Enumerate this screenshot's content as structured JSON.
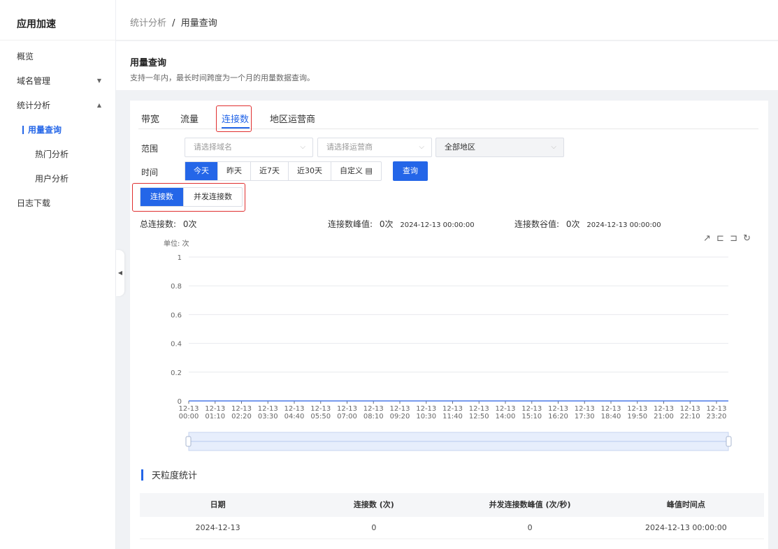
{
  "sidebar": {
    "title": "应用加速",
    "items": [
      {
        "label": "概览"
      },
      {
        "label": "域名管理",
        "caret": "▼"
      },
      {
        "label": "统计分析",
        "caret": "▲"
      },
      {
        "label": "用量查询"
      },
      {
        "label": "热门分析"
      },
      {
        "label": "用户分析"
      },
      {
        "label": "日志下载"
      }
    ],
    "collapse_icon": "◀"
  },
  "breadcrumb": {
    "parent": "统计分析",
    "sep": "/",
    "current": "用量查询"
  },
  "page": {
    "title": "用量查询",
    "desc": "支持一年内，最长时间跨度为一个月的用量数据查询。"
  },
  "tabs": [
    {
      "label": "带宽"
    },
    {
      "label": "流量"
    },
    {
      "label": "连接数",
      "active": true
    },
    {
      "label": "地区运营商"
    }
  ],
  "filters": {
    "range_label": "范围",
    "domain_placeholder": "请选择域名",
    "isp_placeholder": "请选择运营商",
    "region_value": "全部地区",
    "time_label": "时间",
    "time_options": [
      "今天",
      "昨天",
      "近7天",
      "近30天",
      "自定义 ▤"
    ],
    "query_button": "查询"
  },
  "subtabs": [
    "连接数",
    "并发连接数"
  ],
  "stats": {
    "total_label": "总连接数:",
    "total_value": "0次",
    "peak_label": "连接数峰值:",
    "peak_value": "0次",
    "peak_time": "2024-12-13 00:00:00",
    "valley_label": "连接数谷值:",
    "valley_value": "0次",
    "valley_time": "2024-12-13 00:00:00"
  },
  "toolbox_icons": [
    "export-icon",
    "zoom-icon",
    "zoom-reset-icon",
    "refresh-icon"
  ],
  "colors": {
    "accent": "#2466e8",
    "highlight": "#e02f2f"
  },
  "chart_data": {
    "type": "line",
    "ylabel": "单位: 次",
    "ylim": [
      0,
      1
    ],
    "yticks": [
      "0",
      "0.2",
      "0.4",
      "0.6",
      "0.8",
      "1"
    ],
    "x": [
      "00:00",
      "01:10",
      "02:20",
      "03:30",
      "04:40",
      "05:50",
      "07:00",
      "08:10",
      "09:20",
      "10:30",
      "11:40",
      "12:50",
      "14:00",
      "15:10",
      "16:20",
      "17:30",
      "18:40",
      "19:50",
      "21:00",
      "22:10",
      "23:20"
    ],
    "x_date": "12-13",
    "series": [
      {
        "values": [
          0,
          0,
          0,
          0,
          0,
          0,
          0,
          0,
          0,
          0,
          0,
          0,
          0,
          0,
          0,
          0,
          0,
          0,
          0,
          0,
          0
        ]
      }
    ]
  },
  "daily": {
    "title": "天粒度统计",
    "columns": [
      "日期",
      "连接数 (次)",
      "并发连接数峰值 (次/秒)",
      "峰值时间点"
    ],
    "rows": [
      [
        "2024-12-13",
        "0",
        "0",
        "2024-12-13 00:00:00"
      ]
    ]
  }
}
